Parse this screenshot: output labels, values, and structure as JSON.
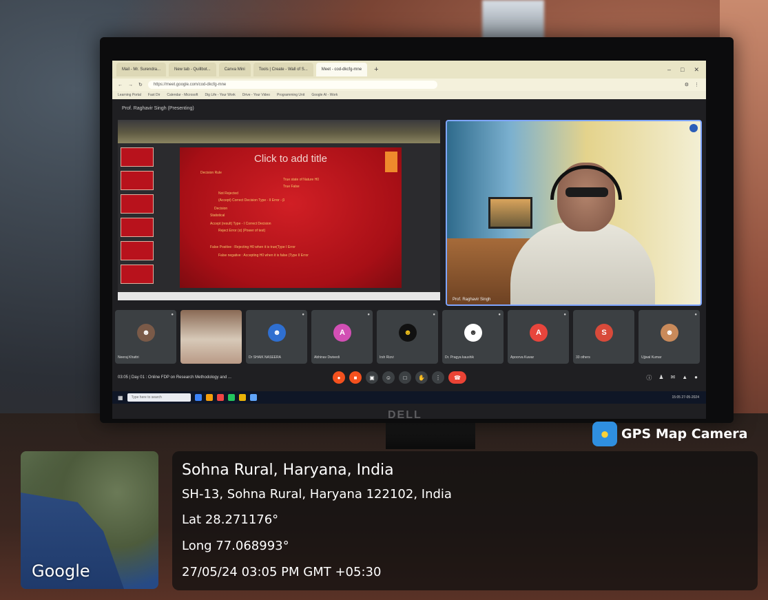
{
  "browser": {
    "tabs": [
      {
        "label": "Mail - Mr. Surendra..."
      },
      {
        "label": "New tab - Quillbot..."
      },
      {
        "label": "Canva Mini"
      },
      {
        "label": "Tools | Create - Wall of S..."
      },
      {
        "label": "Meet - cod-dkcfg-mne",
        "active": true
      }
    ],
    "new_tab_symbol": "+",
    "url": "https://meet.google.com/cod-dkcfg-mne",
    "bookmarks": [
      "Learning Portal",
      "Fast Dir",
      "Calendar - Microsoft",
      "Dig Life - Your Work",
      "Drive - Your Video",
      "Programming Unit",
      "Google AI - Work"
    ]
  },
  "meet": {
    "presenter_label": "Prof. Raghavir Singh (Presenting)",
    "slide": {
      "title": "Click to add title",
      "lines": [
        "Decision Rule",
        "True state of Nature    H0",
        "True         False",
        "Not Rejected",
        "(Accept)     Correct Decision     Type - II Error - β",
        "Decision",
        "Statistical",
        "Accept (result)   Type - I        Correct Decision",
        "Reject            Error (α)       (Power of test)",
        "False Positive : Rejecting H0 when it is true(Type I Error",
        "False negative : Accepting H0 when it is false (Type II Error"
      ]
    },
    "speaker_name": "Prof. Raghavir Singh",
    "participants": [
      {
        "name": "Neeraj Khattri",
        "initial": "",
        "color": "#7a5a48",
        "video": false
      },
      {
        "name": "",
        "initial": "",
        "color": "",
        "video": true
      },
      {
        "name": "Dr SHAIK NASEERA",
        "initial": "",
        "color": "#2f6fd0",
        "video": false
      },
      {
        "name": "Abhinav Dwivedi",
        "initial": "A",
        "color": "#d24fb4",
        "video": false
      },
      {
        "name": "Irsh Rizvi",
        "initial": "",
        "color": "#f2c21b",
        "video": false
      },
      {
        "name": "Dr. Pragya kaushik",
        "initial": "",
        "color": "#ffffff",
        "video": false
      },
      {
        "name": "Apoorva Kuwar",
        "initial": "A",
        "color": "#e8453c",
        "video": false
      },
      {
        "name": "33 others",
        "initial": "S",
        "color": "#d84a3a",
        "video": false
      },
      {
        "name": "Ujjwal Kumar",
        "initial": "",
        "color": "#c98a5a",
        "video": false
      }
    ],
    "meeting_info": "03:05 | Day 01 : Online FDP on Research Methodology and ...",
    "controls": [
      "mic",
      "camera",
      "captions",
      "emoji",
      "present",
      "hand",
      "more",
      "end-call"
    ]
  },
  "taskbar": {
    "search_placeholder": "Type here to search",
    "tray_time": "15:05",
    "tray_date": "27-05-2024"
  },
  "monitor": {
    "brand": "DELL"
  },
  "gps": {
    "brand": "GPS Map Camera",
    "map_label": "Google",
    "place": "Sohna Rural, Haryana, India",
    "address": "SH-13, Sohna Rural, Haryana 122102, India",
    "lat": "Lat 28.271176°",
    "long": "Long 77.068993°",
    "datetime": "27/05/24 03:05 PM GMT +05:30"
  },
  "colors": {
    "slide_red": "#c4161d",
    "meet_bg": "#1f1f22",
    "end_call": "#ea4335",
    "gps_logo": "#2f8fe0"
  }
}
